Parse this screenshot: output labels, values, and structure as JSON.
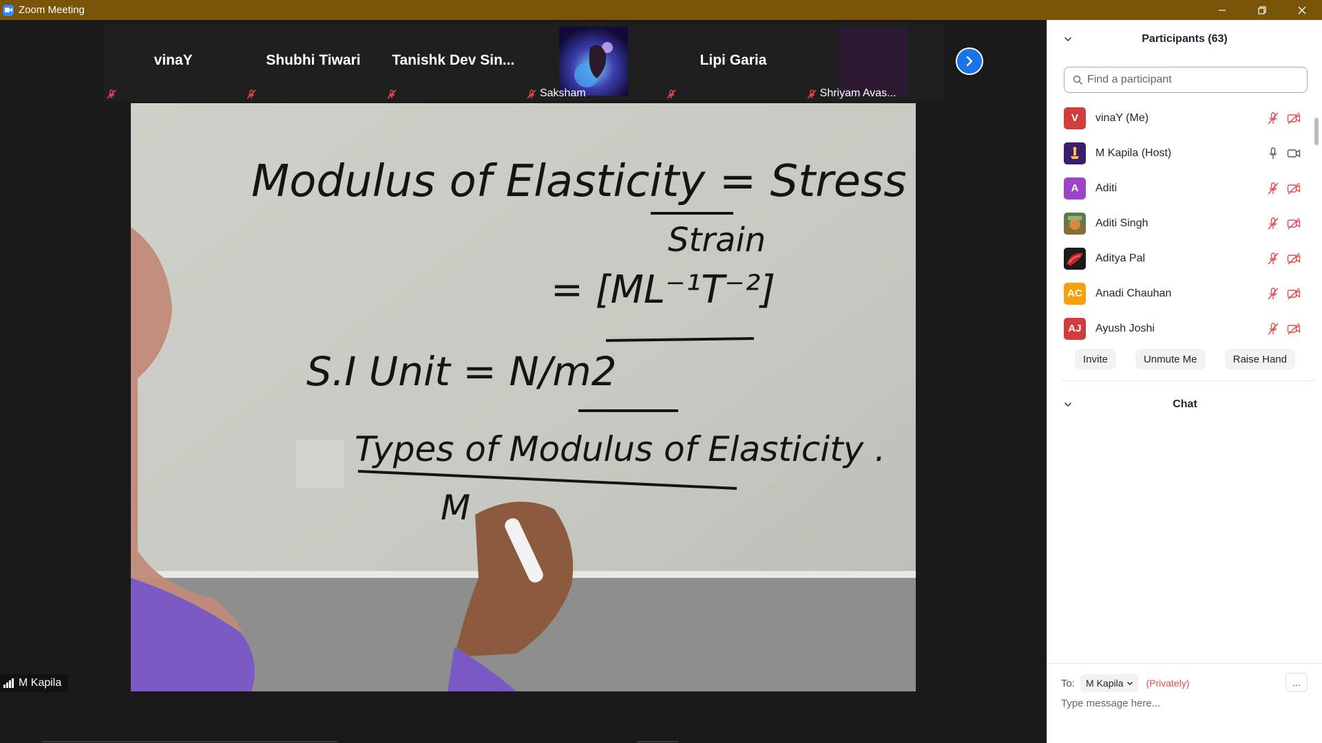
{
  "window": {
    "title": "Zoom Meeting",
    "controls": [
      "minimize",
      "restore",
      "close"
    ]
  },
  "video_strip": {
    "tiles": [
      {
        "name": "vinaY",
        "muted": true,
        "type": "name"
      },
      {
        "name": "Shubhi Tiwari",
        "muted": true,
        "type": "name"
      },
      {
        "name": "Tanishk  Dev  Sin...",
        "muted": true,
        "type": "name"
      },
      {
        "name": "Saksham",
        "muted": true,
        "type": "image"
      },
      {
        "name": "Lipi Garia",
        "muted": true,
        "type": "name"
      },
      {
        "name": "Shriyam Avas...",
        "muted": true,
        "type": "image"
      }
    ],
    "next_icon": "chevron-right-icon"
  },
  "main_video": {
    "speaker": "M Kapila",
    "whiteboard_lines": [
      "Modulus of Elasticity = Stress",
      "Strain",
      "= [ML⁻¹T⁻²]",
      "S.I Unit = N/m2",
      "Types of Modulus of Elasticity .",
      "M"
    ]
  },
  "participants_panel": {
    "title": "Participants (63)",
    "search_placeholder": "Find a participant",
    "participants": [
      {
        "name": "vinaY (Me)",
        "initials": "V",
        "color": "#d13c3c",
        "mic": "muted",
        "video": "off"
      },
      {
        "name": "M Kapila (Host)",
        "initials": "",
        "color": "#3b1d6e",
        "mic": "on",
        "video": "on"
      },
      {
        "name": "Aditi",
        "initials": "A",
        "color": "#9b44c7",
        "mic": "muted",
        "video": "off"
      },
      {
        "name": "Aditi Singh",
        "initials": "",
        "color": "#7a8a5a",
        "mic": "muted",
        "video": "off"
      },
      {
        "name": "Aditya Pal",
        "initials": "",
        "color": "#c8232c",
        "mic": "muted",
        "video": "off"
      },
      {
        "name": "Anadi Chauhan",
        "initials": "AC",
        "color": "#f5a00f",
        "mic": "muted",
        "video": "off"
      },
      {
        "name": "Ayush Joshi",
        "initials": "AJ",
        "color": "#d13c3c",
        "mic": "muted",
        "video": "off"
      }
    ],
    "actions": [
      "Invite",
      "Unmute Me",
      "Raise Hand"
    ]
  },
  "chat_panel": {
    "title": "Chat",
    "to_label": "To:",
    "recipient": "M Kapila",
    "privacy": "(Privately)",
    "more_label": "...",
    "message_placeholder": "Type message here..."
  },
  "colors": {
    "titlebar": "#7a5408",
    "accent_blue": "#1a73e8",
    "muted_red": "#e5484d"
  }
}
